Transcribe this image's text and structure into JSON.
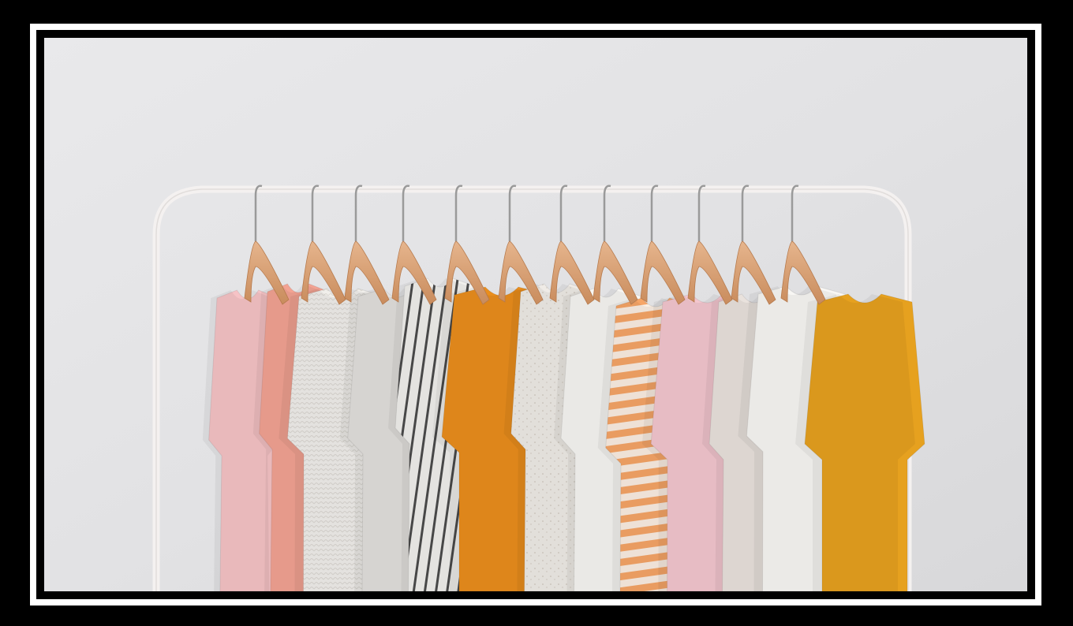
{
  "image": {
    "subject": "clothes-rack",
    "colors": {
      "frame": "#000000",
      "mat": "#ffffff",
      "wall": "#e3e3e5",
      "rack": "#f2efee",
      "hanger": "#d79f72",
      "hook": "#9a9a9a"
    },
    "garments": [
      {
        "name": "pink-blouse",
        "color": "#f6c3c6"
      },
      {
        "name": "coral-top",
        "color": "#f3a393"
      },
      {
        "name": "white-knit-sweater",
        "color": "#f1efeb"
      },
      {
        "name": "grey-knit-cardigan",
        "color": "#e2e0dd"
      },
      {
        "name": "striped-shirt",
        "color": "#ecebe8"
      },
      {
        "name": "orange-tshirt",
        "color": "#ea8e1d"
      },
      {
        "name": "speckled-tshirt",
        "color": "#efebe6"
      },
      {
        "name": "white-tshirt",
        "color": "#f7f6f3"
      },
      {
        "name": "orange-striped-tshirt",
        "color": "#f6a567"
      },
      {
        "name": "pink-tshirt",
        "color": "#f4c7cf"
      },
      {
        "name": "oatmeal-tshirt",
        "color": "#e9e2dd"
      },
      {
        "name": "white-tshirt-2",
        "color": "#f8f7f4"
      },
      {
        "name": "mustard-dress",
        "color": "#e6a11f"
      }
    ]
  }
}
